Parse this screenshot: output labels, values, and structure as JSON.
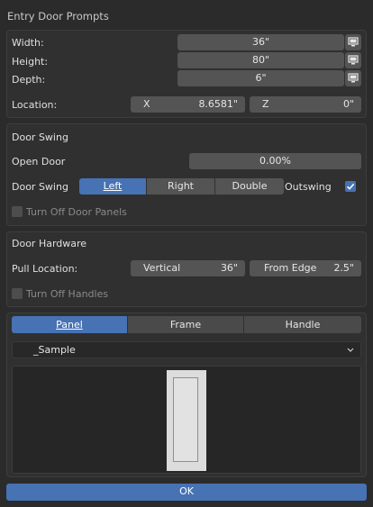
{
  "window_title": "Entry Door Prompts",
  "dimensions": {
    "width_label": "Width:",
    "width_value": "36\"",
    "height_label": "Height:",
    "height_value": "80\"",
    "depth_label": "Depth:",
    "depth_value": "6\"",
    "location_label": "Location:",
    "x_label": "X",
    "x_value": "8.6581\"",
    "z_label": "Z",
    "z_value": "0\""
  },
  "door_swing": {
    "section_title": "Door Swing",
    "open_door_label": "Open Door",
    "open_door_value": "0.00%",
    "swing_label": "Door Swing",
    "options": [
      "Left",
      "Right",
      "Double"
    ],
    "selected": "Left",
    "outswing_label": "Outswing",
    "outswing_checked": true,
    "turn_off_panels_label": "Turn Off Door Panels",
    "turn_off_panels_checked": false
  },
  "door_hardware": {
    "section_title": "Door Hardware",
    "pull_location_label": "Pull Location:",
    "vertical_label": "Vertical",
    "vertical_value": "36\"",
    "from_edge_label": "From Edge",
    "from_edge_value": "2.5\"",
    "turn_off_handles_label": "Turn Off Handles",
    "turn_off_handles_checked": false
  },
  "library": {
    "tabs": [
      "Panel",
      "Frame",
      "Handle"
    ],
    "active_tab": "Panel",
    "selected_item": "_Sample"
  },
  "ok_label": "OK",
  "colors": {
    "accent": "#4772b3",
    "background": "#2b2b2b",
    "panel": "#303030",
    "field": "#545454"
  }
}
